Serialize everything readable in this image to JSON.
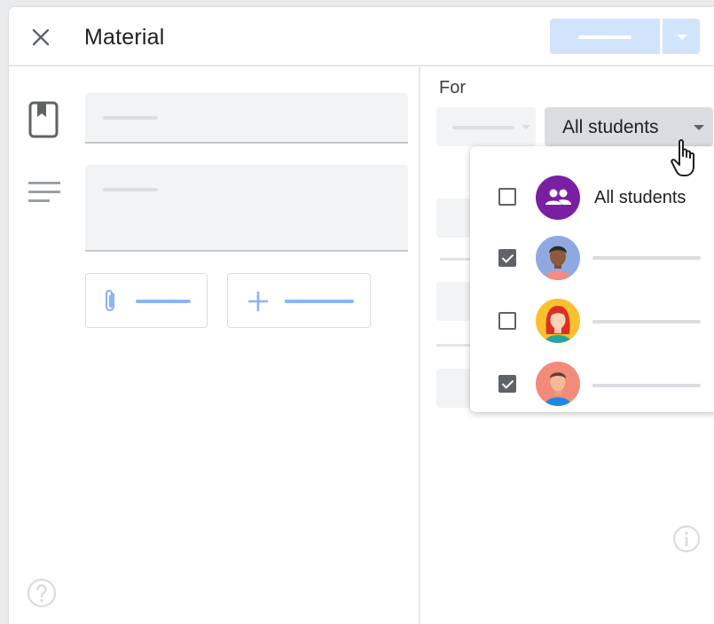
{
  "dialog": {
    "title": "Material"
  },
  "audience": {
    "for_label": "For",
    "selected": "All students",
    "options": [
      {
        "label": "All students",
        "checked": false,
        "type": "group"
      },
      {
        "label": "",
        "checked": true,
        "type": "student"
      },
      {
        "label": "",
        "checked": false,
        "type": "student"
      },
      {
        "label": "",
        "checked": true,
        "type": "student"
      }
    ]
  },
  "colors": {
    "accent_light": "#d2e3fc",
    "attach_accent": "#8ab4f8",
    "group_avatar": "#7b1fa2",
    "checkbox": "#5f6368"
  },
  "icons": {
    "close": "close-icon",
    "title_field": "book-icon",
    "description_field": "notes-icon",
    "attach": "paperclip-icon",
    "create": "plus-icon",
    "help": "help-icon",
    "info": "info-icon",
    "group": "people-icon"
  }
}
